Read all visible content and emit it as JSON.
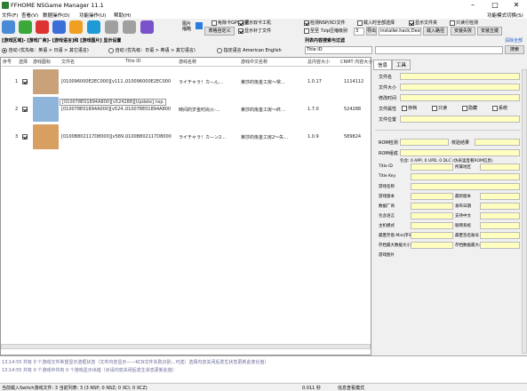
{
  "window": {
    "title": "FFHOME NSGame Manager 11.1"
  },
  "menu": [
    "文件(F)",
    "查看(V)",
    "数据操作(D)",
    "功能操作(U)",
    "帮助(H)"
  ],
  "menu_right": "功能模式切换(S)",
  "toolbar": {
    "icons": [
      "open-file-icon",
      "add-folder-icon",
      "delete-icon",
      "search-icon",
      "refresh-icon",
      "sync-icon",
      "check-icon",
      "stop-icon",
      "settings-icon"
    ],
    "icon_colors": [
      "#4a8bd8",
      "#3aa83a",
      "#d33",
      "#3b6fd8",
      "#f0a020",
      "#1e9ad6",
      "#a0a0a0",
      "#a0a0a0",
      "#7b52c9"
    ],
    "extra_icon_label": "图片\n缩略",
    "custom_btn": "表格自定义",
    "checks": [
      {
        "label": "免除卡GPS数据",
        "checked": false
      },
      {
        "label": "显示双卡工机",
        "checked": true
      },
      {
        "label": "显示补丁文件",
        "checked": true
      },
      {
        "label": "显示对应文件",
        "checked": true
      },
      {
        "label": "检测NSP/XCI文件",
        "checked": true
      },
      {
        "label": "显示多次检测",
        "checked": false
      },
      {
        "label": "载入时全部选择",
        "checked": false
      },
      {
        "label": "显示文件夹",
        "checked": true
      },
      {
        "label": "只读行检测",
        "checked": false
      },
      {
        "label": "只显示与一个保存的文件",
        "checked": false
      },
      {
        "label": "常用",
        "checked": true
      }
    ],
    "search_label": "至至 7zip压缩级别",
    "level_value": "3",
    "path_placeholder": "installer.hack;Desktop",
    "path_btn": "载入路径",
    "dl_btn": "安装失败",
    "save_btn": "安装五键",
    "prev_btn": "导出",
    "next_btn": "复制"
  },
  "filter": {
    "label": "[游戏区域]- [游戏厂商]- [游戏语言]和 [游戏图片] 显示设置",
    "col_label": "列表内容搜索与过滤",
    "clear_link": "清除全部",
    "options": [
      {
        "label": "自动 (优先级：英语 > 日语 > 其它语言)",
        "checked": true
      },
      {
        "label": "自动 (优先级：日语 > 英语 > 其它语言)",
        "checked": false
      },
      {
        "label": "指定语言 American English",
        "checked": false
      }
    ],
    "search_field": "Title ID",
    "search_btn": "搜索"
  },
  "table": {
    "headers": [
      "序号",
      "选择",
      "游戏图标",
      "文件名",
      "Title ID",
      "游戏名称",
      "游戏中文名称",
      "总内容大小",
      "CNMT 内容大小"
    ],
    "rows": [
      {
        "idx": "1",
        "checked": true,
        "file": "[010096000E2EC000][v111...",
        "tid": "010096000E2EC000",
        "name": "ライチゃラ！カ—ん…",
        "cname": "莱莎的炼金工房～常…",
        "ver": "1.0.17",
        "size": "1114112",
        "thumb_color": "#c9a27a"
      },
      {
        "idx": "2",
        "checked": true,
        "file": "[010078E01894A000][v524...",
        "tid": "010078E01894A800",
        "name": "時间的岁金时尚火-…",
        "cname": "莱莎的炼金工房～终…",
        "ver": "1.7.0",
        "size": "524288",
        "thumb_color": "#8fb4d9",
        "tooltip": "[010078E01894A800][v524288][Update].nsp"
      },
      {
        "idx": "3",
        "checked": true,
        "file": "[0100B802117D8000][v589...",
        "tid": "0100B802117D8000",
        "name": "ライチゃラ！カ—ン2…",
        "cname": "莱莎的炼金工房2～失…",
        "ver": "1.0.9",
        "size": "589824",
        "thumb_color": "#d8a060"
      }
    ]
  },
  "details": {
    "tabs": [
      "信息",
      "工具"
    ],
    "fields_top": [
      "文件名",
      "文件大小",
      "修改时间",
      "文件属性",
      "文件位置"
    ],
    "attr_checks": [
      "存档",
      "只读",
      "隐藏",
      "系统"
    ],
    "rom_labels": [
      "ROM检测",
      "ROM组成"
    ],
    "rom_mid_label": "校验结果",
    "rom_note": "包含: 0 APP, 0 UPD, 0 DLC (仿表里直看ROM信息)",
    "fields": [
      [
        "Title ID",
        "所属地区"
      ],
      [
        "Title Key",
        ""
      ],
      [
        "游戏名称",
        ""
      ],
      [
        "游戏版本",
        "最新版本"
      ],
      [
        "数据厂商",
        "发布日期"
      ],
      [
        "包含语言",
        "支持中文"
      ],
      [
        "主机模式",
        "联网系统"
      ],
      [
        "最匿存盘 Min(序号)",
        "最匿签名账号"
      ],
      [
        "存档最大数据大小",
        "存档数据最大小"
      ],
      [
        "游戏图片",
        ""
      ]
    ]
  },
  "log": [
    "13:14:55 共有 0 个游戏文件希望显示选框状态（文件内容显示——KCN文件失败识别...可选）选择内容关闭后发生状态更新此变化值）",
    "13:14:55 共有 0 个游戏中共有 0 个游戏显示出错（对请内容关闭后发生状态更新此值）"
  ],
  "status": {
    "left": "当前载入Switch游戏文件: 3   当前列表: 3 (3 NSP; 0 NSZ; 0 XCI; 0 XCZ)",
    "time": "0.011 秒",
    "right": "信息查看模式"
  }
}
